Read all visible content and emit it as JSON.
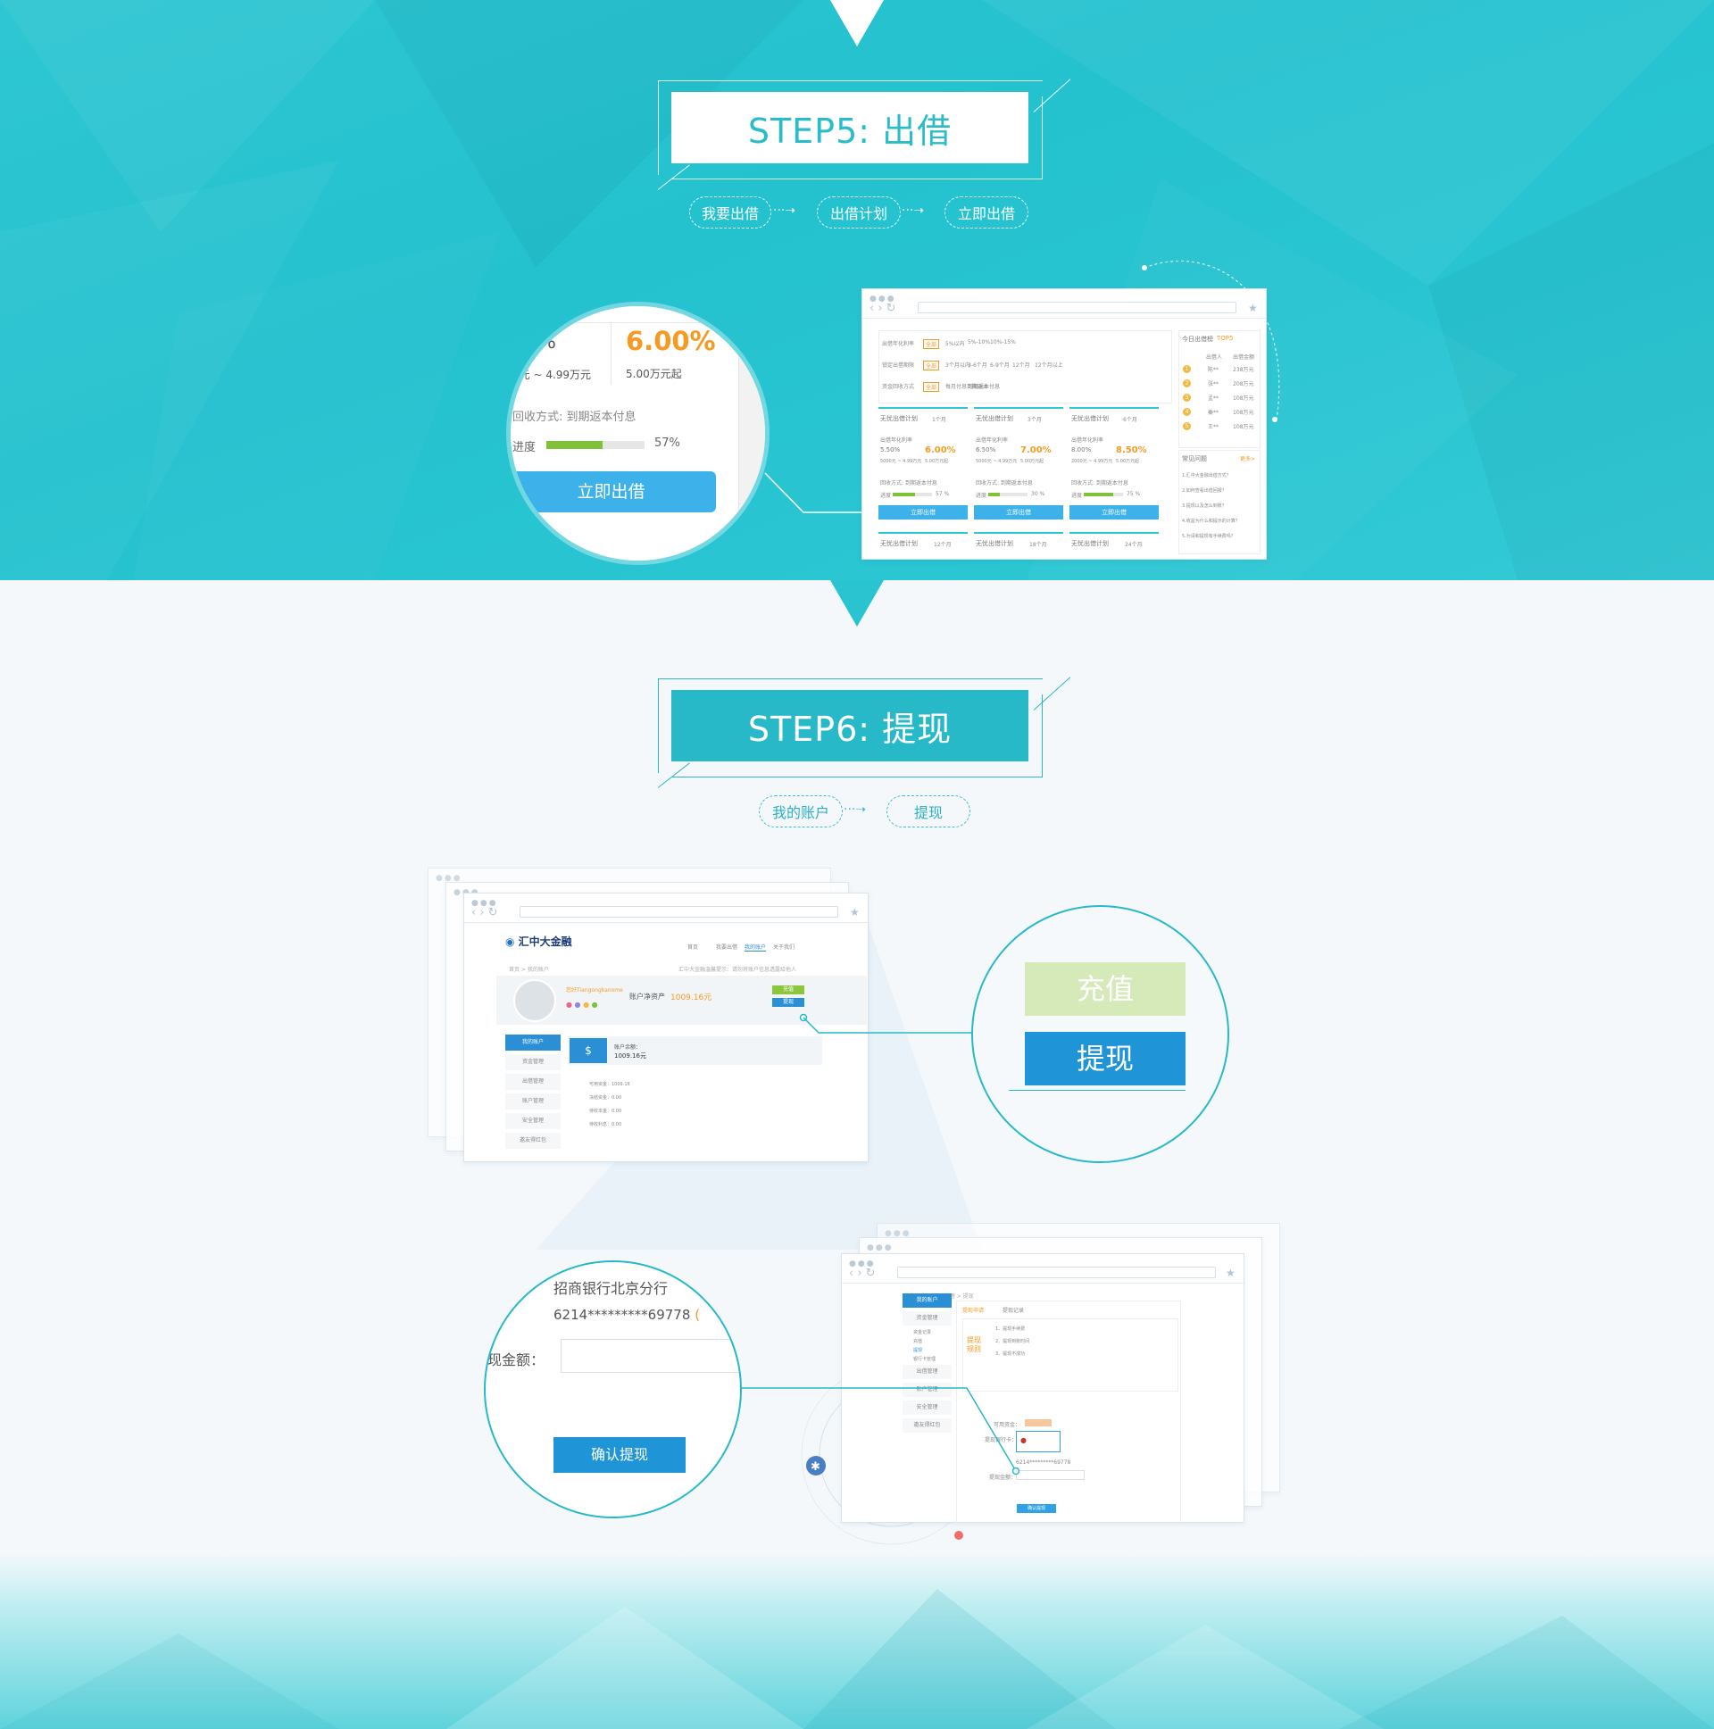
{
  "step5": {
    "title": "STEP5: 出借",
    "flow": [
      "我要出借",
      "出借计划",
      "立即出借"
    ],
    "zoom": {
      "rate_partial": "%",
      "rate": "6.00%",
      "amount_range_partial": "0元 ~ 4.99万元",
      "min_amount": "5.00万元起",
      "repay_method": "回收方式: 到期返本付息",
      "progress_label": "进度",
      "progress_value": 57,
      "progress_text": "57%",
      "button": "立即出借"
    },
    "browser": {
      "filters": [
        {
          "label": "出借年化利率",
          "options": [
            "全部",
            "5%以内",
            "5%-10%",
            "10%-15%"
          ]
        },
        {
          "label": "锁定出借期限",
          "options": [
            "全部",
            "3个月以内",
            "3-6个月",
            "6-9个月",
            "12个月",
            "12个月以上"
          ]
        },
        {
          "label": "资金回收方式",
          "options": [
            "全部",
            "每月付息到期返本",
            "到期返本付息"
          ]
        }
      ],
      "plans": [
        {
          "name": "无忧出借计划",
          "term": "1个月",
          "rate_label": "出借年化利率",
          "base_rate": "5.50%",
          "rate": "6.00%",
          "range": "5000元 ~ 4.99万元",
          "min": "5.00万元起",
          "repay": "回收方式: 到期返本付息",
          "progress": 57,
          "progress_text": "57 %",
          "button": "立即出借"
        },
        {
          "name": "无忧出借计划",
          "term": "3个月",
          "rate_label": "出借年化利率",
          "base_rate": "6.50%",
          "rate": "7.00%",
          "range": "5000元 ~ 4.99万元",
          "min": "5.00万元起",
          "repay": "回收方式: 到期返本付息",
          "progress": 30,
          "progress_text": "30 %",
          "button": "立即出借"
        },
        {
          "name": "无忧出借计划",
          "term": "6个月",
          "rate_label": "出借年化利率",
          "base_rate": "8.00%",
          "rate": "8.50%",
          "range": "2000元 ~ 4.99万元",
          "min": "5.00万元起",
          "repay": "回收方式: 到期返本付息",
          "progress": 75,
          "progress_text": "75 %",
          "button": "立即出借"
        }
      ],
      "more_plans": [
        {
          "name": "无忧出借计划",
          "term": "12个月"
        },
        {
          "name": "无忧出借计划",
          "term": "18个月"
        },
        {
          "name": "无忧出借计划",
          "term": "24个月"
        }
      ],
      "ranking": {
        "title": "今日出借榜",
        "subtitle": "TOP5",
        "head": [
          "出借人",
          "出借金额"
        ],
        "rows": [
          {
            "rank": "1",
            "name": "陈**",
            "amount": "238万元"
          },
          {
            "rank": "2",
            "name": "张**",
            "amount": "208万元"
          },
          {
            "rank": "3",
            "name": "孟**",
            "amount": "108万元"
          },
          {
            "rank": "4",
            "name": "秦**",
            "amount": "108万元"
          },
          {
            "rank": "5",
            "name": "王**",
            "amount": "108万元"
          }
        ]
      },
      "faq": {
        "title": "常见问题",
        "more": "更多>",
        "items": [
          "1.汇中大金融出借方式？",
          "2.如何查看出借回报？",
          "3.提现以及怎么到账？",
          "4.收益为什么和提示的计算？",
          "5.为请和提现有手续费吗？"
        ]
      }
    }
  },
  "step6": {
    "title": "STEP6: 提现",
    "flow": [
      "我的账户",
      "提现"
    ],
    "account_browser": {
      "logo": "汇中大金融",
      "nav": [
        "首页",
        "我要出借",
        "我的账户",
        "关于我们"
      ],
      "breadcrumb": "首页 > 我的账户",
      "notice": "汇中大金融温馨提示：请勿将账户信息透露给他人",
      "user": "您好Tiangongkanome",
      "net_assets_label": "账户净资产",
      "net_assets": "1009.16元",
      "recharge": "充值",
      "withdraw": "提现",
      "sidebar": [
        "我的账户",
        "资金管理",
        "出借管理",
        "账户管理",
        "安全管理",
        "邀友得红包"
      ],
      "balance_label": "账户余额：",
      "balance": "1009.16元",
      "details": [
        "可用资金：1009.16",
        "冻结资金：0.00",
        "待收本金：0.00",
        "待收利息：0.00"
      ]
    },
    "zoom_buttons": {
      "recharge": "充值",
      "withdraw": "提现"
    },
    "withdraw_zoom": {
      "bank": "招商银行北京分行",
      "card": "6214*********69778",
      "card_suffix": "(",
      "amount_label": "现金额：",
      "confirm": "确认提现"
    },
    "withdraw_browser": {
      "breadcrumb": "我的账户 > 资金管理 > 提现",
      "tabs": [
        "提现申请",
        "提现记录"
      ],
      "rules_title": "提现规则",
      "rules": [
        "1、提现手续费",
        "2、提现到账时间",
        "3、提现不成功"
      ],
      "sidebar": [
        "我的账户",
        "资金管理",
        "出借管理",
        "账户管理",
        "安全管理",
        "邀友得红包"
      ],
      "sub_items": [
        "资金记录",
        "充值",
        "提现",
        "银行卡管理"
      ],
      "available_label": "可用资金：",
      "bank_label": "提现银行卡：",
      "card": "6214*********69778",
      "amount_label": "提现金额：",
      "confirm": "确认提现"
    }
  }
}
